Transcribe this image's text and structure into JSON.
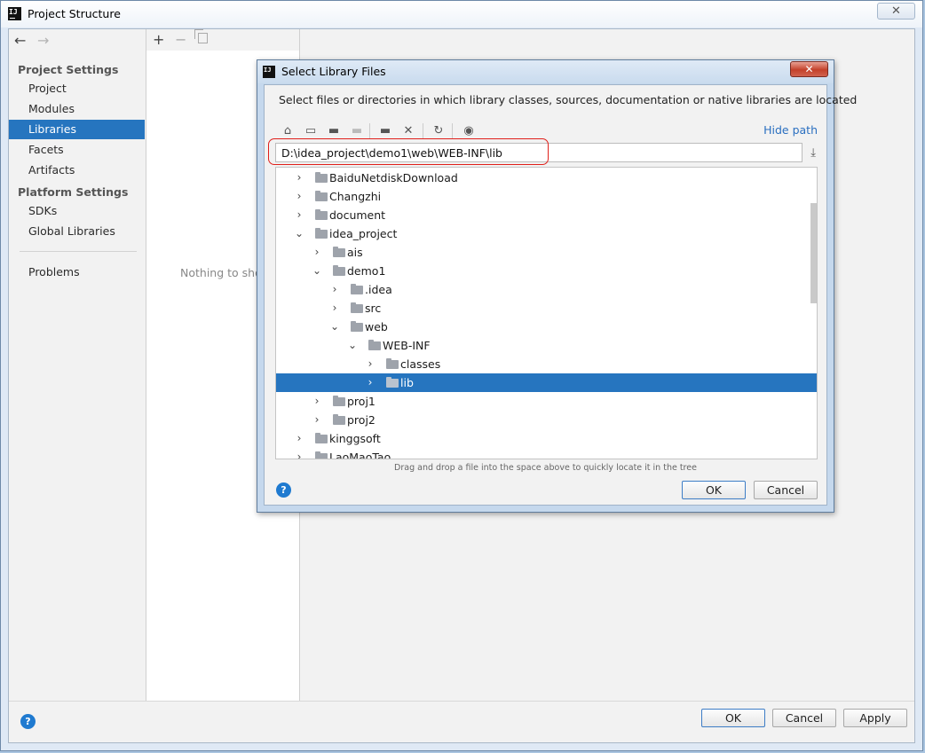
{
  "main": {
    "title": "Project Structure",
    "sidebar": {
      "sections": [
        {
          "heading": "Project Settings",
          "items": [
            "Project",
            "Modules",
            "Libraries",
            "Facets",
            "Artifacts"
          ]
        },
        {
          "heading": "Platform Settings",
          "items": [
            "SDKs",
            "Global Libraries"
          ]
        }
      ],
      "extra_item": "Problems",
      "selected": "Libraries"
    },
    "middle": {
      "empty_text": "Nothing to sho"
    },
    "buttons": {
      "ok": "OK",
      "cancel": "Cancel",
      "apply": "Apply",
      "help": "?"
    }
  },
  "dialog": {
    "title": "Select Library Files",
    "description": "Select files or directories in which library classes, sources, documentation or native libraries are located",
    "toolbar_icons": [
      "home-icon",
      "desktop-icon",
      "new-folder-icon",
      "folder-disabled-icon",
      "new-folder-plus-icon",
      "delete-icon",
      "refresh-icon",
      "show-hidden-icon"
    ],
    "hide_path_label": "Hide path",
    "path": "D:\\idea_project\\demo1\\web\\WEB-INF\\lib",
    "tree": [
      {
        "label": "BaiduNetdiskDownload",
        "depth": 0,
        "expanded": false
      },
      {
        "label": "Changzhi",
        "depth": 0,
        "expanded": false
      },
      {
        "label": "document",
        "depth": 0,
        "expanded": false
      },
      {
        "label": "idea_project",
        "depth": 0,
        "expanded": true
      },
      {
        "label": "ais",
        "depth": 1,
        "expanded": false
      },
      {
        "label": "demo1",
        "depth": 1,
        "expanded": true
      },
      {
        "label": ".idea",
        "depth": 2,
        "expanded": false
      },
      {
        "label": "src",
        "depth": 2,
        "expanded": false
      },
      {
        "label": "web",
        "depth": 2,
        "expanded": true
      },
      {
        "label": "WEB-INF",
        "depth": 3,
        "expanded": true
      },
      {
        "label": "classes",
        "depth": 4,
        "expanded": false
      },
      {
        "label": "lib",
        "depth": 4,
        "expanded": false,
        "selected": true
      },
      {
        "label": "proj1",
        "depth": 1,
        "expanded": false
      },
      {
        "label": "proj2",
        "depth": 1,
        "expanded": false
      },
      {
        "label": "kinggsoft",
        "depth": 0,
        "expanded": false
      },
      {
        "label": "LaoMaoTao",
        "depth": 0,
        "expanded": false
      }
    ],
    "hint": "Drag and drop a file into the space above to quickly locate it in the tree",
    "buttons": {
      "ok": "OK",
      "cancel": "Cancel",
      "help": "?"
    }
  }
}
